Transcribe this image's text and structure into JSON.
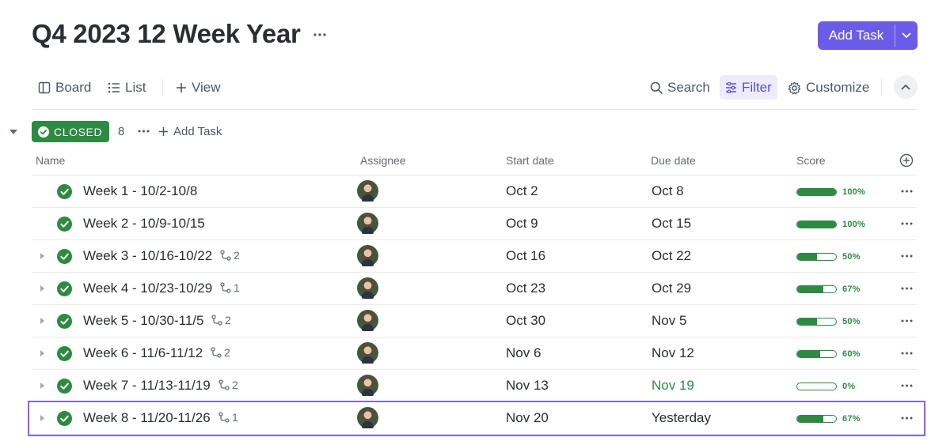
{
  "page": {
    "title": "Q4 2023 12 Week Year"
  },
  "header": {
    "add_task_label": "Add Task"
  },
  "toolbar": {
    "board": "Board",
    "list": "List",
    "view": "View",
    "search": "Search",
    "filter": "Filter",
    "customize": "Customize"
  },
  "group": {
    "status": "CLOSED",
    "count": "8",
    "add_task": "Add Task",
    "status_color": "#2e8a43"
  },
  "columns": {
    "name": "Name",
    "assignee": "Assignee",
    "start": "Start date",
    "due": "Due date",
    "score": "Score"
  },
  "accent": "#6b5ce7",
  "rows": [
    {
      "name": "Week 1 - 10/2-10/8",
      "subtasks": "",
      "start": "Oct 2",
      "due": "Oct 8",
      "score": 100,
      "score_label": "100%",
      "expandable": false,
      "due_green": false
    },
    {
      "name": "Week 2 - 10/9-10/15",
      "subtasks": "",
      "start": "Oct 9",
      "due": "Oct 15",
      "score": 100,
      "score_label": "100%",
      "expandable": false,
      "due_green": false
    },
    {
      "name": "Week 3 - 10/16-10/22",
      "subtasks": "2",
      "start": "Oct 16",
      "due": "Oct 22",
      "score": 50,
      "score_label": "50%",
      "expandable": true,
      "due_green": false
    },
    {
      "name": "Week 4 - 10/23-10/29",
      "subtasks": "1",
      "start": "Oct 23",
      "due": "Oct 29",
      "score": 67,
      "score_label": "67%",
      "expandable": true,
      "due_green": false
    },
    {
      "name": "Week 5 - 10/30-11/5",
      "subtasks": "2",
      "start": "Oct 30",
      "due": "Nov 5",
      "score": 50,
      "score_label": "50%",
      "expandable": true,
      "due_green": false
    },
    {
      "name": "Week 6 - 11/6-11/12",
      "subtasks": "2",
      "start": "Nov 6",
      "due": "Nov 12",
      "score": 60,
      "score_label": "60%",
      "expandable": true,
      "due_green": false
    },
    {
      "name": "Week 7 - 11/13-11/19",
      "subtasks": "2",
      "start": "Nov 13",
      "due": "Nov 19",
      "score": 0,
      "score_label": "0%",
      "expandable": true,
      "due_green": true
    },
    {
      "name": "Week 8 - 11/20-11/26",
      "subtasks": "1",
      "start": "Nov 20",
      "due": "Yesterday",
      "score": 67,
      "score_label": "67%",
      "expandable": true,
      "due_green": false,
      "highlight": true
    }
  ]
}
